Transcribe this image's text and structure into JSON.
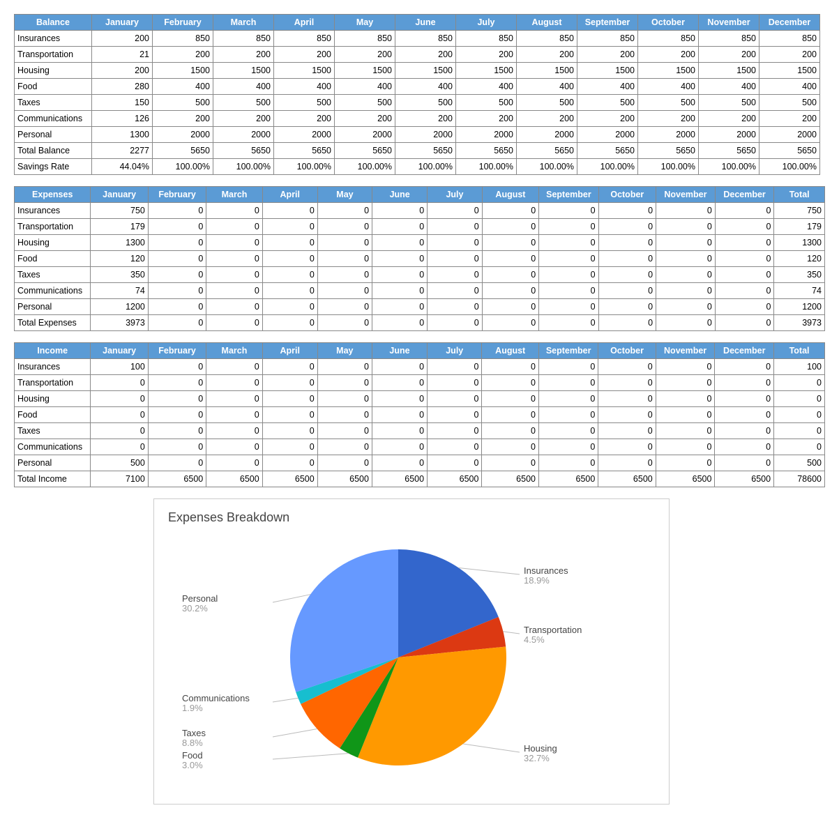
{
  "months": [
    "January",
    "February",
    "March",
    "April",
    "May",
    "June",
    "July",
    "August",
    "September",
    "October",
    "November",
    "December"
  ],
  "tables": {
    "balance": {
      "title": "Balance",
      "hasTotalCol": false,
      "rows": [
        {
          "label": "Insurances",
          "vals": [
            "200",
            "850",
            "850",
            "850",
            "850",
            "850",
            "850",
            "850",
            "850",
            "850",
            "850",
            "850"
          ]
        },
        {
          "label": "Transportation",
          "vals": [
            "21",
            "200",
            "200",
            "200",
            "200",
            "200",
            "200",
            "200",
            "200",
            "200",
            "200",
            "200"
          ]
        },
        {
          "label": "Housing",
          "vals": [
            "200",
            "1500",
            "1500",
            "1500",
            "1500",
            "1500",
            "1500",
            "1500",
            "1500",
            "1500",
            "1500",
            "1500"
          ]
        },
        {
          "label": "Food",
          "vals": [
            "280",
            "400",
            "400",
            "400",
            "400",
            "400",
            "400",
            "400",
            "400",
            "400",
            "400",
            "400"
          ]
        },
        {
          "label": "Taxes",
          "vals": [
            "150",
            "500",
            "500",
            "500",
            "500",
            "500",
            "500",
            "500",
            "500",
            "500",
            "500",
            "500"
          ]
        },
        {
          "label": "Communications",
          "vals": [
            "126",
            "200",
            "200",
            "200",
            "200",
            "200",
            "200",
            "200",
            "200",
            "200",
            "200",
            "200"
          ]
        },
        {
          "label": "Personal",
          "vals": [
            "1300",
            "2000",
            "2000",
            "2000",
            "2000",
            "2000",
            "2000",
            "2000",
            "2000",
            "2000",
            "2000",
            "2000"
          ]
        },
        {
          "label": "Total Balance",
          "vals": [
            "2277",
            "5650",
            "5650",
            "5650",
            "5650",
            "5650",
            "5650",
            "5650",
            "5650",
            "5650",
            "5650",
            "5650"
          ]
        },
        {
          "label": "Savings Rate",
          "vals": [
            "44.04%",
            "100.00%",
            "100.00%",
            "100.00%",
            "100.00%",
            "100.00%",
            "100.00%",
            "100.00%",
            "100.00%",
            "100.00%",
            "100.00%",
            "100.00%"
          ]
        }
      ]
    },
    "expenses": {
      "title": "Expenses",
      "hasTotalCol": true,
      "totalHeader": "Total",
      "rows": [
        {
          "label": "Insurances",
          "vals": [
            "750",
            "0",
            "0",
            "0",
            "0",
            "0",
            "0",
            "0",
            "0",
            "0",
            "0",
            "0"
          ],
          "total": "750"
        },
        {
          "label": "Transportation",
          "vals": [
            "179",
            "0",
            "0",
            "0",
            "0",
            "0",
            "0",
            "0",
            "0",
            "0",
            "0",
            "0"
          ],
          "total": "179"
        },
        {
          "label": "Housing",
          "vals": [
            "1300",
            "0",
            "0",
            "0",
            "0",
            "0",
            "0",
            "0",
            "0",
            "0",
            "0",
            "0"
          ],
          "total": "1300"
        },
        {
          "label": "Food",
          "vals": [
            "120",
            "0",
            "0",
            "0",
            "0",
            "0",
            "0",
            "0",
            "0",
            "0",
            "0",
            "0"
          ],
          "total": "120"
        },
        {
          "label": "Taxes",
          "vals": [
            "350",
            "0",
            "0",
            "0",
            "0",
            "0",
            "0",
            "0",
            "0",
            "0",
            "0",
            "0"
          ],
          "total": "350"
        },
        {
          "label": "Communications",
          "vals": [
            "74",
            "0",
            "0",
            "0",
            "0",
            "0",
            "0",
            "0",
            "0",
            "0",
            "0",
            "0"
          ],
          "total": "74"
        },
        {
          "label": "Personal",
          "vals": [
            "1200",
            "0",
            "0",
            "0",
            "0",
            "0",
            "0",
            "0",
            "0",
            "0",
            "0",
            "0"
          ],
          "total": "1200"
        },
        {
          "label": "Total Expenses",
          "vals": [
            "3973",
            "0",
            "0",
            "0",
            "0",
            "0",
            "0",
            "0",
            "0",
            "0",
            "0",
            "0"
          ],
          "total": "3973"
        }
      ]
    },
    "income": {
      "title": "Income",
      "hasTotalCol": true,
      "totalHeader": "Total",
      "rows": [
        {
          "label": "Insurances",
          "vals": [
            "100",
            "0",
            "0",
            "0",
            "0",
            "0",
            "0",
            "0",
            "0",
            "0",
            "0",
            "0"
          ],
          "total": "100"
        },
        {
          "label": "Transportation",
          "vals": [
            "0",
            "0",
            "0",
            "0",
            "0",
            "0",
            "0",
            "0",
            "0",
            "0",
            "0",
            "0"
          ],
          "total": "0"
        },
        {
          "label": "Housing",
          "vals": [
            "0",
            "0",
            "0",
            "0",
            "0",
            "0",
            "0",
            "0",
            "0",
            "0",
            "0",
            "0"
          ],
          "total": "0"
        },
        {
          "label": "Food",
          "vals": [
            "0",
            "0",
            "0",
            "0",
            "0",
            "0",
            "0",
            "0",
            "0",
            "0",
            "0",
            "0"
          ],
          "total": "0"
        },
        {
          "label": "Taxes",
          "vals": [
            "0",
            "0",
            "0",
            "0",
            "0",
            "0",
            "0",
            "0",
            "0",
            "0",
            "0",
            "0"
          ],
          "total": "0"
        },
        {
          "label": "Communications",
          "vals": [
            "0",
            "0",
            "0",
            "0",
            "0",
            "0",
            "0",
            "0",
            "0",
            "0",
            "0",
            "0"
          ],
          "total": "0"
        },
        {
          "label": "Personal",
          "vals": [
            "500",
            "0",
            "0",
            "0",
            "0",
            "0",
            "0",
            "0",
            "0",
            "0",
            "0",
            "0"
          ],
          "total": "500"
        },
        {
          "label": "Total Income",
          "vals": [
            "7100",
            "6500",
            "6500",
            "6500",
            "6500",
            "6500",
            "6500",
            "6500",
            "6500",
            "6500",
            "6500",
            "6500"
          ],
          "total": "78600"
        }
      ]
    }
  },
  "chart": {
    "title": "Expenses Breakdown"
  },
  "chart_data": {
    "type": "pie",
    "title": "Expenses Breakdown",
    "slices": [
      {
        "name": "Insurances",
        "pct": 18.9,
        "value": 750,
        "color": "#3366cc"
      },
      {
        "name": "Transportation",
        "pct": 4.5,
        "value": 179,
        "color": "#dc3912"
      },
      {
        "name": "Housing",
        "pct": 32.7,
        "value": 1300,
        "color": "#ff9900"
      },
      {
        "name": "Food",
        "pct": 3.0,
        "value": 120,
        "color": "#109618"
      },
      {
        "name": "Taxes",
        "pct": 8.8,
        "value": 350,
        "color": "#ff6600"
      },
      {
        "name": "Communications",
        "pct": 1.9,
        "value": 74,
        "color": "#17becf"
      },
      {
        "name": "Personal",
        "pct": 30.2,
        "value": 1200,
        "color": "#6699ff"
      }
    ]
  },
  "col_widths": {
    "label": 98,
    "month": 74,
    "total": 66
  }
}
